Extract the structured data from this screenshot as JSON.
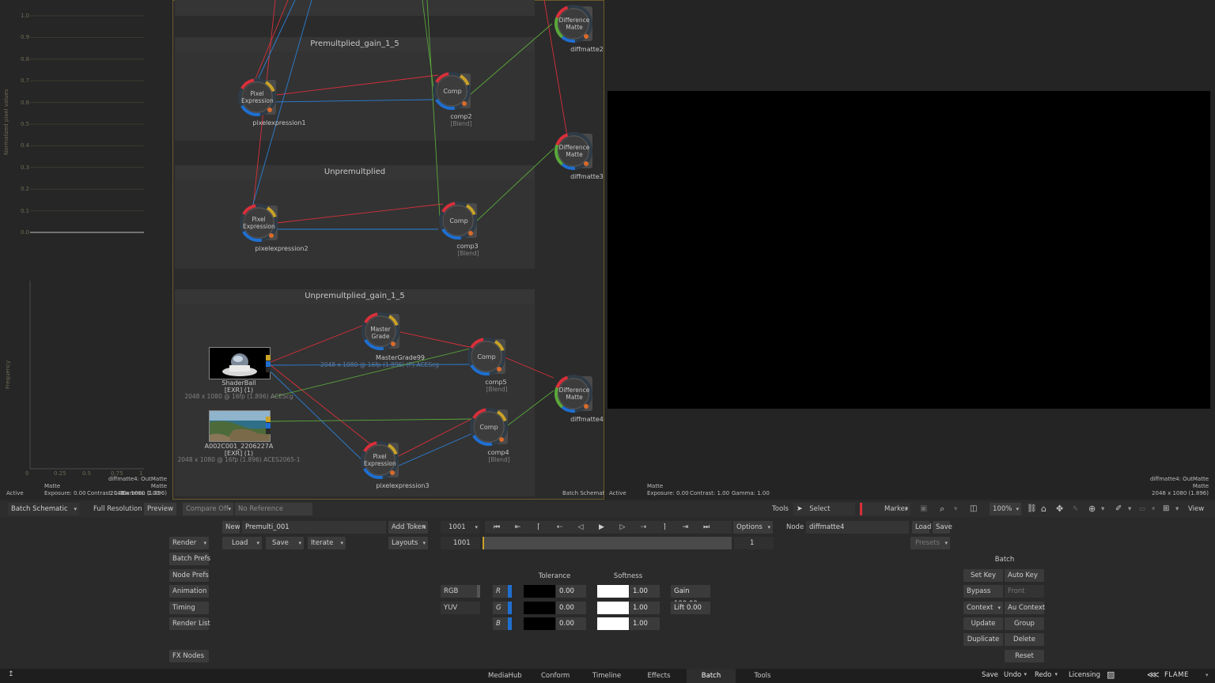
{
  "waveform": {
    "y_axis_label": "Normalized pixel values",
    "ticks": [
      "1.0",
      "0.9",
      "0.8",
      "0.7",
      "0.6",
      "0.5",
      "0.4",
      "0.3",
      "0.2",
      "0.1",
      "0.0"
    ]
  },
  "histogram": {
    "y_axis_label": "Frequency",
    "x_ticks": [
      "0",
      "0.25",
      "0.5",
      "0.75",
      "1"
    ],
    "info_node": "diffmatte4: OutMatte",
    "info_channel": "Matte",
    "info_res": "2048 x 1080 (1.896)"
  },
  "left_status": {
    "active": "Active",
    "exposure": "Exposure: 0.00",
    "contrast": "Contrast: 1.00",
    "gamma": "Gamma: 1.00",
    "matte": "Matte"
  },
  "schematic": {
    "label": "Batch Schematic",
    "groups": [
      {
        "title": "Premultplied_gain_1_5"
      },
      {
        "title": "Unpremultplied"
      },
      {
        "title": "Unpremultplied_gain_1_5"
      }
    ],
    "nodes": {
      "pixelexpression1": {
        "title_l1": "Pixel",
        "title_l2": "Expression",
        "name": "pixelexpression1"
      },
      "comp2": {
        "title": "Comp",
        "name": "comp2",
        "sub": "[Blend]"
      },
      "pixelexpression2": {
        "title_l1": "Pixel",
        "title_l2": "Expression",
        "name": "pixelexpression2"
      },
      "comp3": {
        "title": "Comp",
        "name": "comp3",
        "sub": "[Blend]"
      },
      "mastergrade": {
        "title_l1": "Master",
        "title_l2": "Grade",
        "name": "MasterGrade99",
        "sub": "2048 x 1080 @ 16fp (1.896) (P) ACEScg"
      },
      "comp5": {
        "title": "Comp",
        "name": "comp5",
        "sub": "[Blend]"
      },
      "comp4": {
        "title": "Comp",
        "name": "comp4",
        "sub": "[Blend]"
      },
      "pixelexpression3": {
        "title_l1": "Pixel",
        "title_l2": "Expression",
        "name": "pixelexpression3"
      },
      "diffmatte2": {
        "title_l1": "Difference",
        "title_l2": "Matte",
        "name": "diffmatte2"
      },
      "diffmatte3": {
        "title_l1": "Difference",
        "title_l2": "Matte",
        "name": "diffmatte3"
      },
      "diffmatte4": {
        "title_l1": "Difference",
        "title_l2": "Matte",
        "name": "diffmatte4"
      },
      "shaderball": {
        "name": "ShaderBall",
        "fmt": "[EXR] (1)",
        "sub": "2048 x 1080 @ 16fp (1.896)  ACEScg"
      },
      "a002": {
        "name": "A002C001_2206227A",
        "fmt": "[EXR] (1)",
        "sub": "2048 x 1080 @ 16fp (1.896)  ACES2065-1"
      }
    }
  },
  "viewer": {
    "active": "Active",
    "matte": "Matte",
    "exposure": "Exposure: 0.00",
    "contrast": "Contrast: 1.00",
    "gamma": "Gamma: 1.00",
    "info_node": "diffmatte4: OutMatte",
    "info_channel": "Matte",
    "info_res": "2048 x 1080 (1.896)"
  },
  "toolbar": {
    "view_mode": "Batch Schematic",
    "full_resolution": "Full Resolution",
    "preview": "Preview",
    "compare": "Compare Off",
    "reference": "No Reference",
    "tools": "Tools",
    "select": "Select",
    "marker": "Marker",
    "zoom": "100%",
    "view": "View"
  },
  "batch_controls": {
    "render": "Render",
    "batch_prefs": "Batch Prefs",
    "node_prefs": "Node Prefs",
    "animation": "Animation",
    "timing": "Timing",
    "render_list": "Render List",
    "fx_nodes": "FX Nodes",
    "new": "New",
    "setup_name": "Premulti_001",
    "add_token": "Add Token",
    "load": "Load",
    "save": "Save",
    "iterate": "Iterate",
    "layouts": "Layouts",
    "frame": "1001",
    "frame2": "1001",
    "frame_end": "1",
    "options": "Options",
    "node_label": "Node",
    "node_name": "diffmatte4",
    "node_load": "Load",
    "node_save": "Save",
    "presets": "Presets"
  },
  "matte_controls": {
    "rgb": "RGB",
    "yuv": "YUV",
    "tolerance_header": "Tolerance",
    "softness_header": "Softness",
    "channels": [
      "R",
      "G",
      "B"
    ],
    "tolerance": [
      "0.00",
      "0.00",
      "0.00"
    ],
    "softness": [
      "1.00",
      "1.00",
      "1.00"
    ],
    "gain": "Gain 100.00",
    "lift": "Lift 0.00"
  },
  "right_controls": {
    "batch": "Batch",
    "set_key": "Set Key",
    "auto_key": "Auto Key",
    "bypass": "Bypass",
    "front": "Front",
    "context": "Context",
    "au_context": "Au Context",
    "update": "Update",
    "group": "Group",
    "duplicate": "Duplicate",
    "delete": "Delete",
    "reset": "Reset"
  },
  "tabs": [
    "MediaHub",
    "Conform",
    "Timeline",
    "Effects",
    "Batch",
    "Tools"
  ],
  "status": {
    "arrow": "↥",
    "save": "Save",
    "undo": "Undo",
    "redo": "Redo",
    "licensing": "Licensing",
    "app": "FLAME"
  },
  "colors": {
    "accent_blue": "#1f6fd0",
    "link_red": "#d8303a",
    "link_blue": "#2a7fd4",
    "link_green": "#5aa83a",
    "schematic_border": "#6a5a2a"
  }
}
